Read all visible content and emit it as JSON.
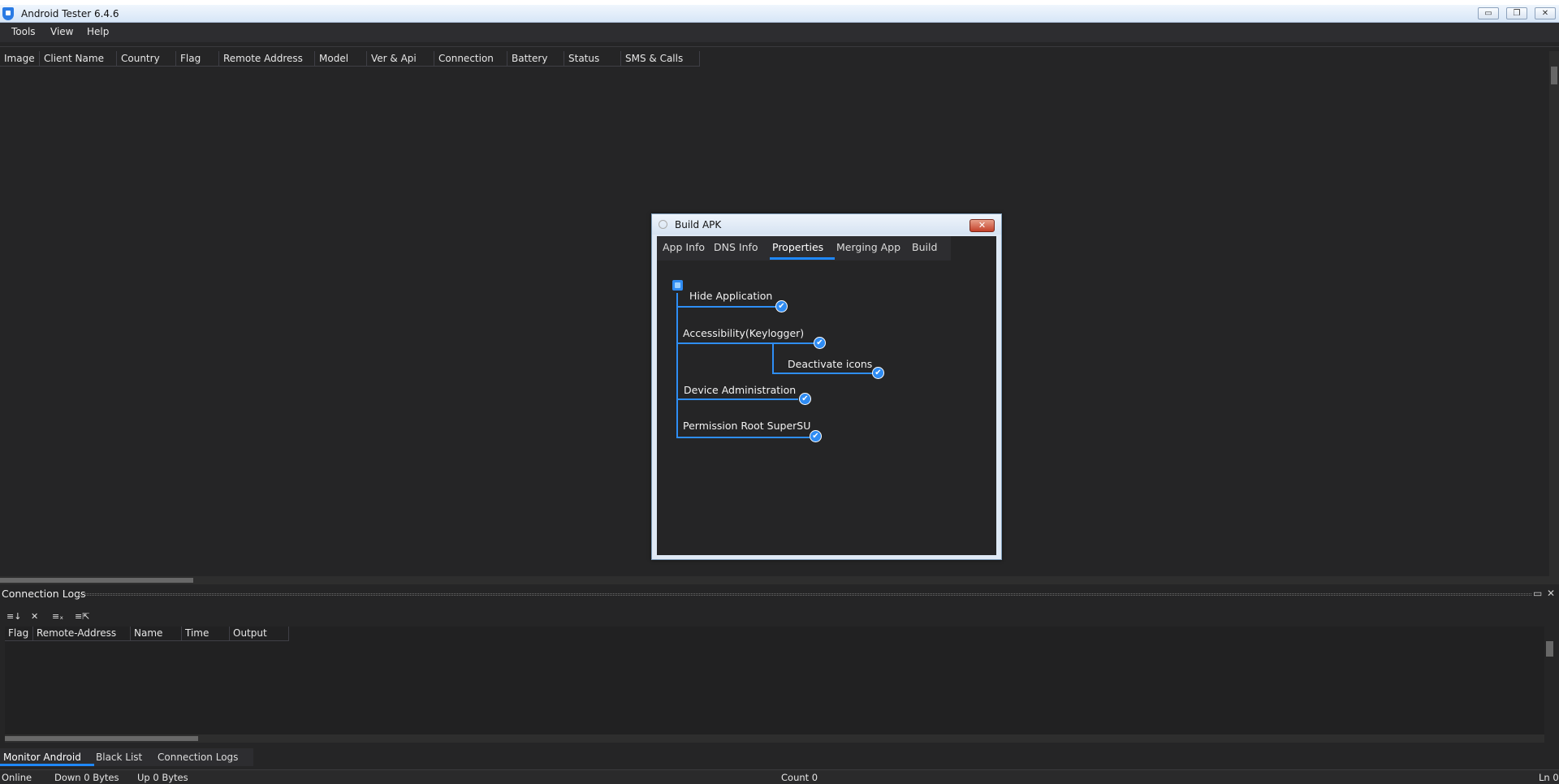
{
  "window": {
    "title": "Android Tester 6.4.6",
    "buttons": {
      "minimize": "▭",
      "restore": "❐",
      "close": "✕"
    }
  },
  "menu": [
    "Tools",
    "View",
    "Help"
  ],
  "client_grid": {
    "columns": [
      "Image",
      "Client Name",
      "Country",
      "Flag",
      "Remote Address",
      "Model",
      "Ver & Api",
      "Connection",
      "Battery",
      "Status",
      "SMS & Calls"
    ]
  },
  "dialog": {
    "title": "Build APK",
    "close_label": "✕",
    "tabs": [
      "App Info",
      "DNS Info",
      "Properties",
      "Merging App",
      "Build"
    ],
    "active_tab": "Properties",
    "properties": [
      {
        "label": "Hide Application",
        "checked": true
      },
      {
        "label": "Accessibility(Keylogger)",
        "checked": true
      },
      {
        "label": "Deactivate icons",
        "checked": true
      },
      {
        "label": "Device Administration",
        "checked": true
      },
      {
        "label": "Permission Root SuperSU",
        "checked": true
      }
    ],
    "check_glyph": "✔"
  },
  "logs_panel": {
    "title": "Connection Logs",
    "maximize_icon": "▭",
    "close_icon": "✕",
    "toolbar_icons": [
      "sort-icon",
      "clear-icon",
      "filter-clear-icon",
      "export-icon"
    ],
    "toolbar_glyphs": [
      "≡↓",
      "✕",
      "≡ₓ",
      "≡⇱"
    ],
    "columns": [
      "Flag",
      "Remote-Address",
      "Name",
      "Time",
      "Output"
    ]
  },
  "bottom_tabs": [
    "Monitor Android",
    "Black List",
    "Connection Logs"
  ],
  "active_bottom_tab": "Monitor Android",
  "status": {
    "state": "Online",
    "down": "Down 0 Bytes",
    "up": "Up 0 Bytes",
    "count": "Count 0",
    "ln": "Ln 0"
  },
  "colors": {
    "accent": "#1f88ff",
    "background": "#252526",
    "titlebar": "#d7e6f7"
  }
}
